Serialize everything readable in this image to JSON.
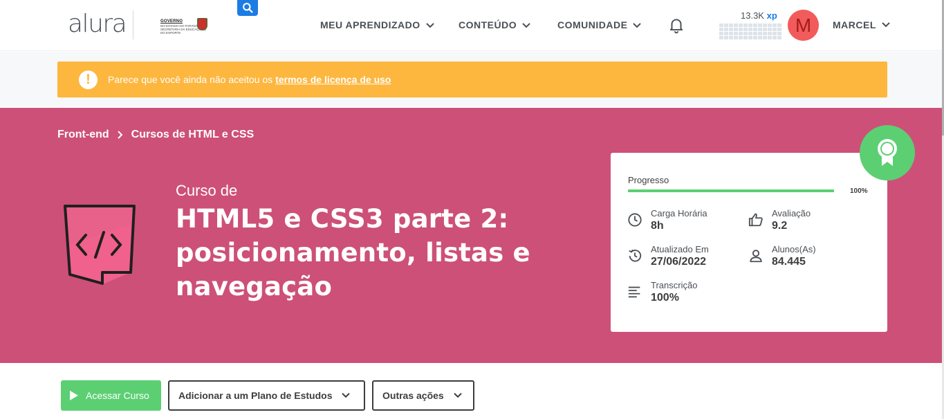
{
  "header": {
    "logo": "alura",
    "gov_logo_title": "GOVERNO",
    "gov_logo_sub1": "DO ESTADO DO PARANÁ",
    "gov_logo_sub2": "SECRETARIA DA EDUCAÇÃO E DO ESPORTE",
    "nav": [
      {
        "label": "MEU APRENDIZADO"
      },
      {
        "label": "CONTEÚDO"
      },
      {
        "label": "COMUNIDADE"
      }
    ],
    "xp_value": "13.3K",
    "xp_unit": "xp",
    "avatar_initial": "M",
    "user_name": "MARCEL"
  },
  "alert": {
    "text": "Parece que você ainda não aceitou os",
    "link": "termos de licença de uso",
    "icon_glyph": "!"
  },
  "breadcrumb": [
    {
      "label": "Front-end"
    },
    {
      "label": "Cursos de HTML e CSS"
    }
  ],
  "course": {
    "pre_title": "Curso de",
    "title": "HTML5 e CSS3 parte 2: posicionamento, listas e navegação",
    "icon": "code-icon"
  },
  "card": {
    "progress_label": "Progresso",
    "progress_value": 1.0,
    "progress_text": "100%",
    "stats": [
      {
        "label": "Carga Horária",
        "value": "8h",
        "icon": "clock-icon"
      },
      {
        "label": "Avaliação",
        "value": "9.2",
        "icon": "thumbs-up-icon"
      },
      {
        "label": "Atualizado Em",
        "value": "27/06/2022",
        "icon": "history-icon"
      },
      {
        "label": "Alunos(As)",
        "value": "84.445",
        "icon": "user-icon"
      },
      {
        "label": "Transcrição",
        "value": "100%",
        "icon": "text-lines-icon"
      }
    ]
  },
  "actions": {
    "access": "Acessar Curso",
    "add_plan": "Adicionar a um Plano de Estudos",
    "other": "Outras ações"
  },
  "colors": {
    "hero": "#cd5079",
    "alert": "#fdb73f",
    "accent_green": "#5ccf73",
    "brand_blue": "#1c7ce4",
    "avatar": "#f25b5b"
  }
}
